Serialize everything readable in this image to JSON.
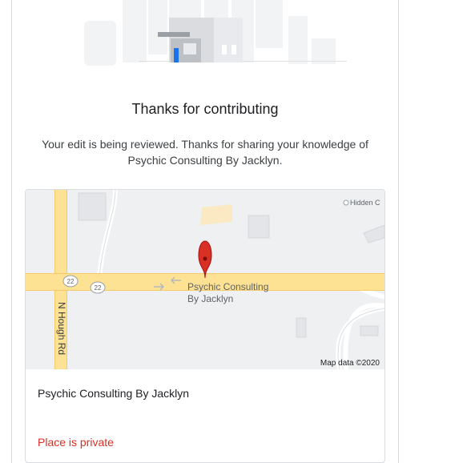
{
  "dialog": {
    "title": "Thanks for contributing",
    "message": "Your edit is being reviewed. Thanks for sharing your knowledge of Psychic Consulting By Jacklyn."
  },
  "map": {
    "marker_label_line1": "Psychic Consulting",
    "marker_label_line2": "By Jacklyn",
    "road_vertical": "N Hough Rd",
    "route_shield_1": "22",
    "route_shield_2": "22",
    "poi_label": "Hidden C",
    "credit": "Map data ©2020",
    "colors": {
      "road": "#fde293",
      "road_edge": "#f3c969",
      "land": "#eef0f2",
      "building": "#e3e5e8",
      "marker": "#d93025"
    }
  },
  "place": {
    "name": "Psychic Consulting By Jacklyn",
    "status": "Place is private"
  },
  "icons": {
    "hero": "storefront-illustration",
    "marker": "map-pin-icon"
  }
}
